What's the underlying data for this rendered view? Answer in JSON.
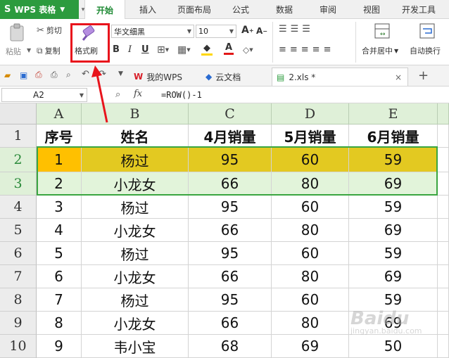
{
  "menubar": {
    "app_label": "WPS 表格",
    "tabs": [
      "开始",
      "插入",
      "页面布局",
      "公式",
      "数据",
      "审阅",
      "视图",
      "开发工具"
    ],
    "active_tab": "开始"
  },
  "ribbon": {
    "paste_label": "粘贴",
    "cut_label": "剪切",
    "copy_label": "复制",
    "format_painter_label": "格式刷",
    "font_name": "华文细黑",
    "font_size": "10",
    "bold_label": "B",
    "italic_label": "I",
    "underline_label": "U",
    "merge_label": "合并居中",
    "wrap_label": "自动换行"
  },
  "doc_tabs": [
    {
      "label": "我的WPS"
    },
    {
      "label": "云文档"
    },
    {
      "label": "2.xls *"
    }
  ],
  "formula_bar": {
    "cell_ref": "A2",
    "fx_label": "fx",
    "formula": "=ROW()-1"
  },
  "sheet": {
    "columns": [
      "A",
      "B",
      "C",
      "D",
      "E"
    ],
    "row_numbers": [
      "1",
      "2",
      "3",
      "4",
      "5",
      "6",
      "7",
      "8",
      "9",
      "10"
    ],
    "header": [
      "序号",
      "姓名",
      "4月销量",
      "5月销量",
      "6月销量"
    ],
    "rows": [
      [
        "1",
        "杨过",
        "95",
        "60",
        "59"
      ],
      [
        "2",
        "小龙女",
        "66",
        "80",
        "69"
      ],
      [
        "3",
        "杨过",
        "95",
        "60",
        "59"
      ],
      [
        "4",
        "小龙女",
        "66",
        "80",
        "69"
      ],
      [
        "5",
        "杨过",
        "95",
        "60",
        "59"
      ],
      [
        "6",
        "小龙女",
        "66",
        "80",
        "69"
      ],
      [
        "7",
        "杨过",
        "95",
        "60",
        "59"
      ],
      [
        "8",
        "小龙女",
        "66",
        "80",
        "69"
      ],
      [
        "9",
        "韦小宝",
        "68",
        "69",
        "50"
      ]
    ]
  },
  "colors": {
    "app_green": "#2c9b3e",
    "row2_fill": "#e3c921",
    "row2_a_fill": "#ffc000",
    "row3_fill": "#e2f4da",
    "highlight_red": "#e8141c"
  },
  "watermark": {
    "text": "Baidu",
    "sub": "jingyan.baidu.com"
  }
}
